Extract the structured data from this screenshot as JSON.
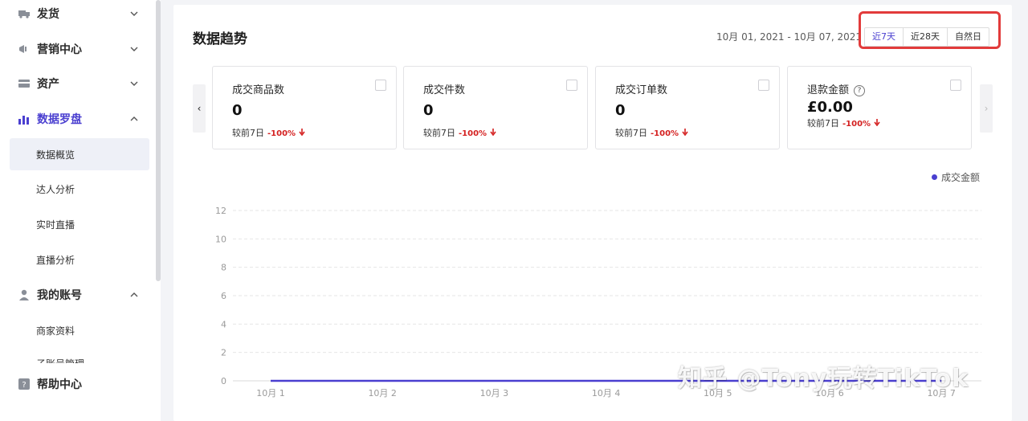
{
  "sidebar": {
    "items": [
      {
        "label": "发货",
        "icon": "truck-icon",
        "expanded": false
      },
      {
        "label": "营销中心",
        "icon": "megaphone-icon",
        "expanded": false
      },
      {
        "label": "资产",
        "icon": "card-icon",
        "expanded": false
      },
      {
        "label": "数据罗盘",
        "icon": "bar-chart-icon",
        "expanded": true,
        "sub": [
          "数据概览",
          "达人分析",
          "实时直播",
          "直播分析"
        ],
        "selected": "数据概览"
      },
      {
        "label": "我的账号",
        "icon": "user-icon",
        "expanded": true,
        "sub": [
          "商家资料",
          "子账号管理"
        ]
      },
      {
        "label": "帮助中心",
        "icon": "help-icon",
        "expanded": false
      }
    ]
  },
  "main": {
    "title": "数据趋势",
    "date_range": "10月 01, 2021 - 10月 07, 2021",
    "range_buttons": [
      "近7天",
      "近28天",
      "自然日"
    ],
    "active_range": "近7天",
    "accent_color": "#4a3fd0",
    "metrics": [
      {
        "label": "成交商品数",
        "value": "0",
        "compare": "较前7日",
        "delta": "-100%"
      },
      {
        "label": "成交件数",
        "value": "0",
        "compare": "较前7日",
        "delta": "-100%"
      },
      {
        "label": "成交订单数",
        "value": "0",
        "compare": "较前7日",
        "delta": "-100%"
      },
      {
        "label": "退款金额",
        "value": "£0.00",
        "compare": "较前7日",
        "delta": "-100%",
        "has_help": true
      }
    ],
    "carousel_prev": "‹",
    "carousel_next": "›"
  },
  "chart_data": {
    "type": "line",
    "x": [
      "10月 1",
      "10月 2",
      "10月 3",
      "10月 4",
      "10月 5",
      "10月 6",
      "10月 7"
    ],
    "series": [
      {
        "name": "成交金额",
        "values": [
          0,
          0,
          0,
          0,
          0,
          0,
          0
        ],
        "color": "#4a3fd0"
      }
    ],
    "yticks": [
      0,
      2,
      4,
      6,
      8,
      10,
      12
    ],
    "ylim": [
      0,
      12
    ],
    "grid": true,
    "legend": "top-right"
  },
  "watermark": "知乎 @Tony玩转TikTok"
}
